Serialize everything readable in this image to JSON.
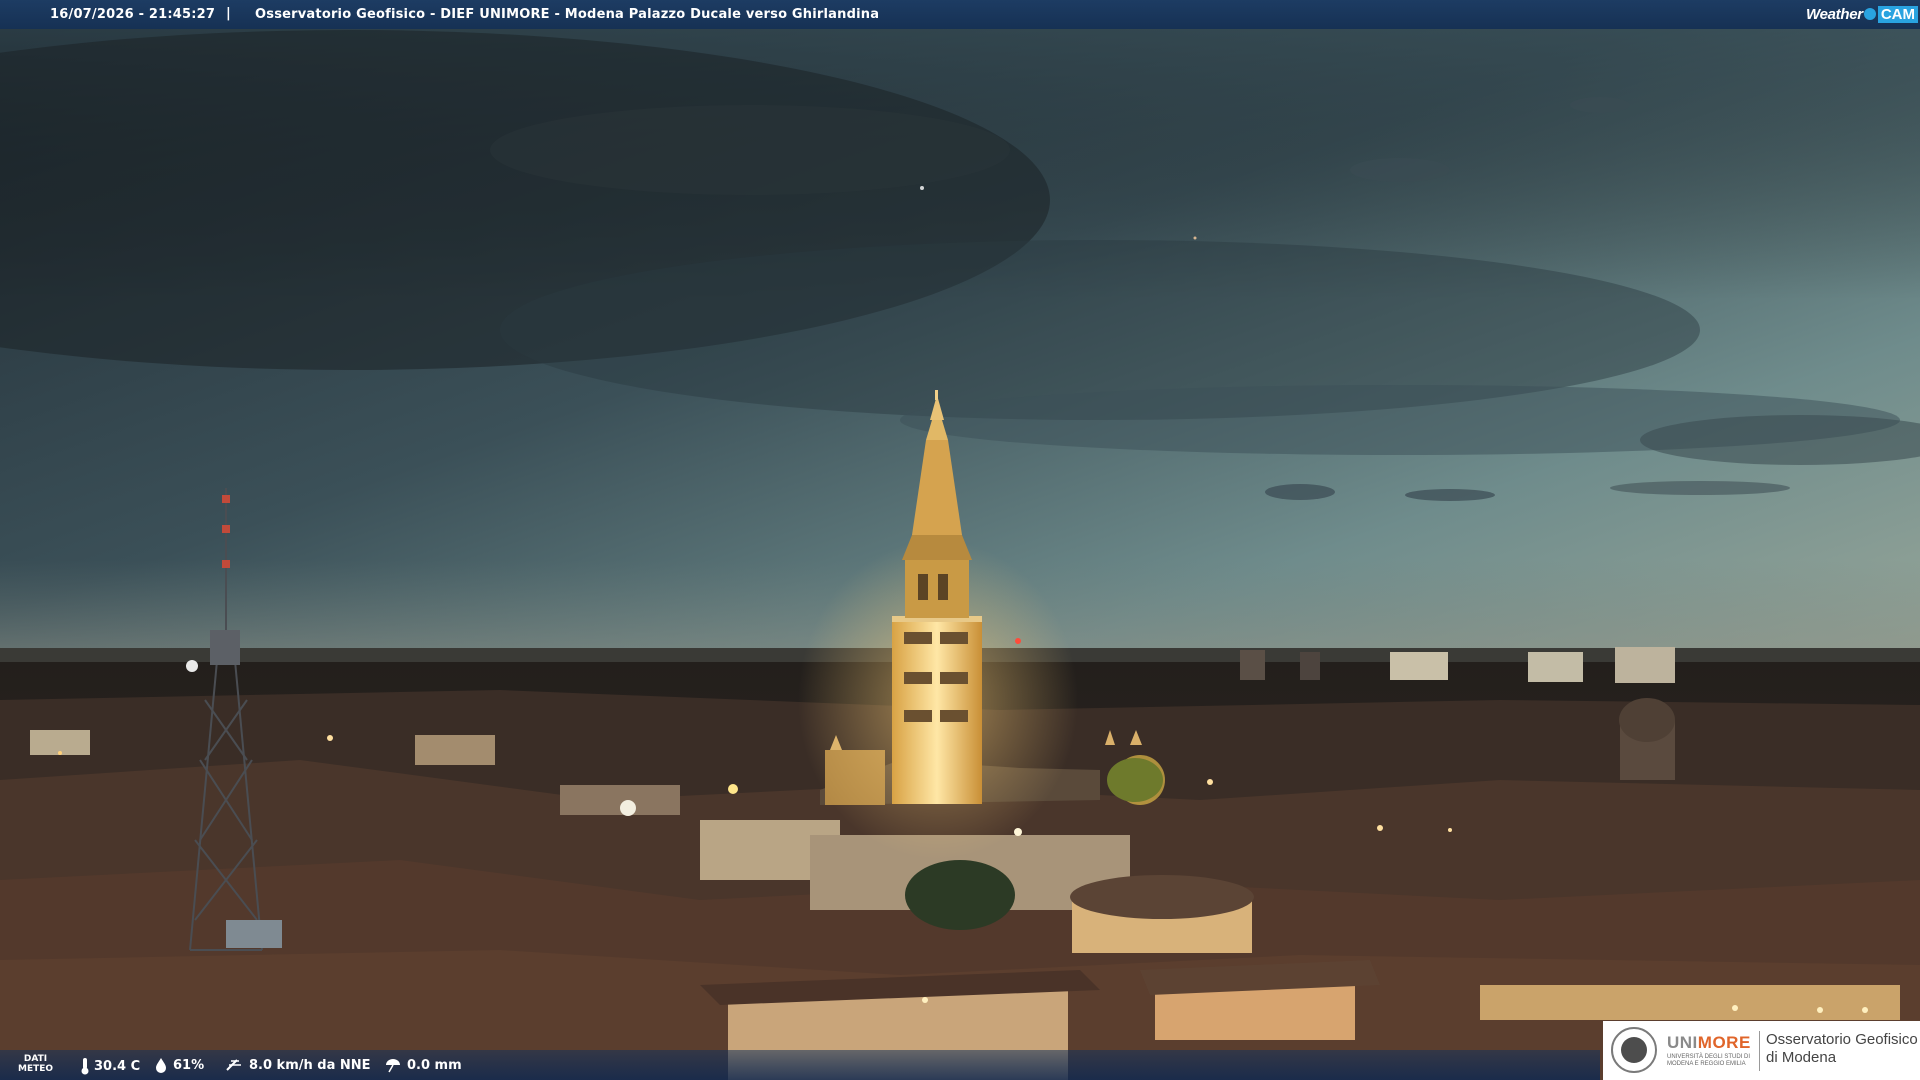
{
  "header": {
    "timestamp": "16/07/2026 - 21:45:27",
    "separator": "|",
    "title": "Osservatorio Geofisico - DIEF UNIMORE - Modena Palazzo Ducale verso Ghirlandina",
    "brand_left": "Weather",
    "brand_right": "CAM"
  },
  "meteo": {
    "label_line1": "DATI",
    "label_line2": "METEO",
    "temperature": "30.4 C",
    "humidity": "61%",
    "wind": "8.0 km/h da NNE",
    "rain": "0.0 mm"
  },
  "logo": {
    "uni_part1": "UNI",
    "uni_part2": "MORE",
    "uni_subtitle": "UNIVERSITÀ DEGLI STUDI DI MODENA E REGGIO EMILIA",
    "observatory_line1": "Osservatorio Geofisico",
    "observatory_line2": "di Modena"
  },
  "colors": {
    "bar": "#163154",
    "accent": "#29a3e0",
    "unimore_orange": "#e0652a"
  },
  "icons": {
    "temperature": "thermometer-icon",
    "humidity": "droplet-icon",
    "wind": "wind-icon",
    "rain": "rain-gauge-icon"
  }
}
